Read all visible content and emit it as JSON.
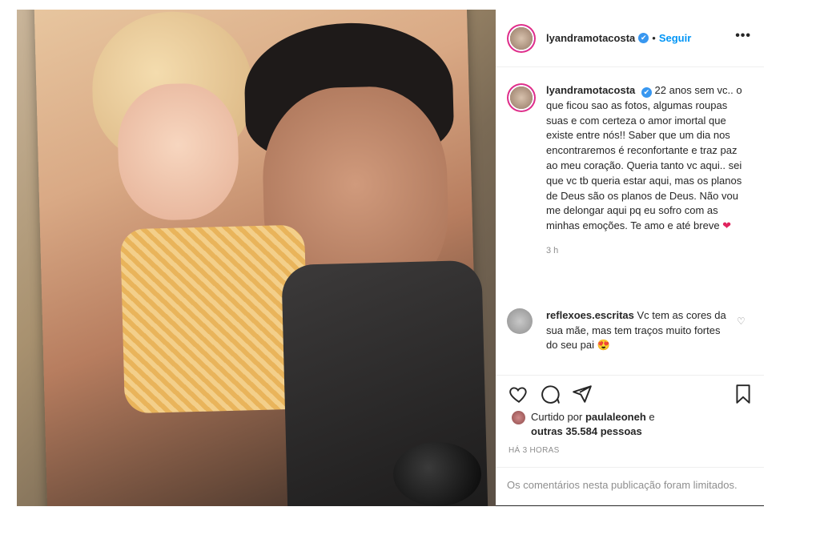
{
  "post": {
    "username": "lyandramotacosta",
    "verified_badge": "✔",
    "separator": "•",
    "follow_label": "Seguir",
    "more_icon": "•••"
  },
  "caption": {
    "username": "lyandramotacosta",
    "text": "22 anos sem vc.. o que ficou sao as fotos, algumas roupas suas e com certeza o amor imortal que existe entre nós!! Saber que um dia nos encontraremos é reconfortante e traz paz ao meu coração. Queria tanto vc aqui.. sei que vc tb queria estar aqui, mas os planos de Deus são os planos de Deus. Não vou me delongar aqui pq eu sofro com as minhas emoções. Te amo e até breve",
    "emoji": "❤",
    "time_ago": "3 h"
  },
  "comment": {
    "username": "reflexoes.escritas",
    "text": "Vc tem as cores da sua mãe, mas tem traços muito fortes do seu pai",
    "emoji": "😍",
    "like_icon": "heart-outline"
  },
  "actions": {
    "icons": [
      "heart-outline-icon",
      "comment-icon",
      "share-icon",
      "bookmark-icon"
    ]
  },
  "likes": {
    "prefix": "Curtido por",
    "user": "paulaleoneh",
    "conjunction": "e",
    "others": "outras 35.584 pessoas"
  },
  "post_date": "HÁ 3 HORAS",
  "comments_limited": "Os comentários nesta publicação foram limitados.",
  "colors": {
    "link_blue": "#0095f6",
    "text": "#262626",
    "muted": "#8e8e8e",
    "heart_red": "#e0245e"
  }
}
